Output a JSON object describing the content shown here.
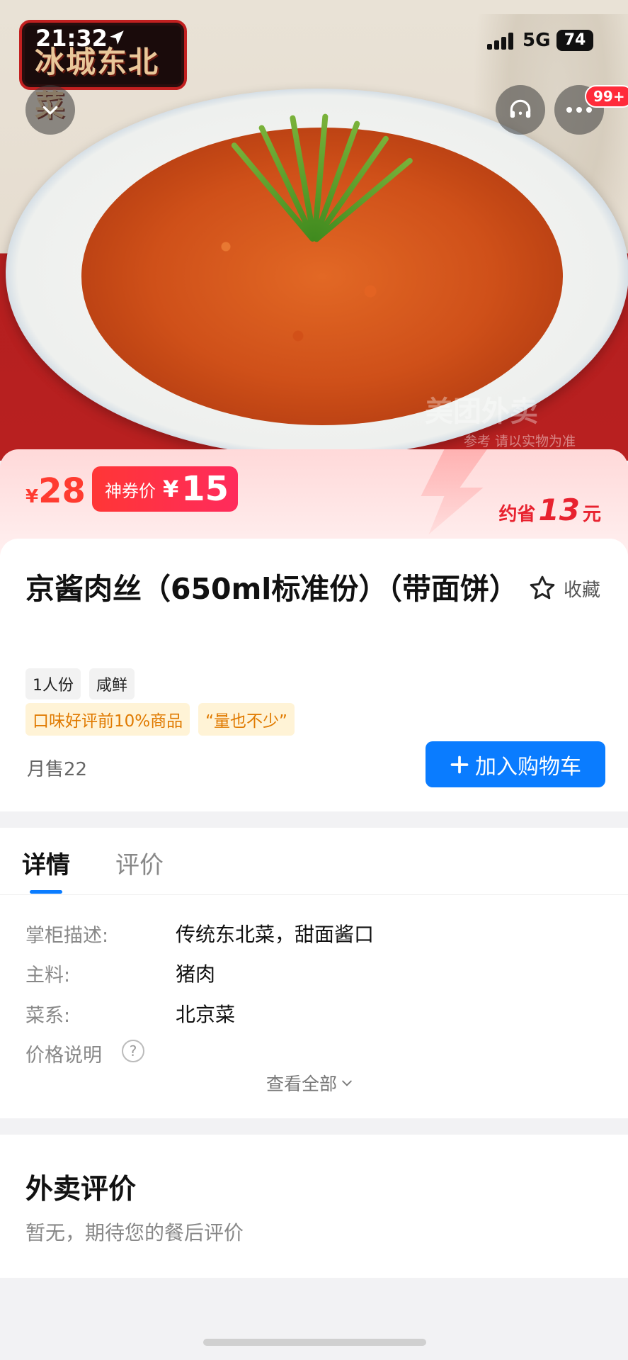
{
  "status_bar": {
    "time": "21:32",
    "network": "5G",
    "battery": "74"
  },
  "store": {
    "logo_text": "冰城东北菜"
  },
  "hero": {
    "watermark": "美团外卖",
    "watermark_note": "参考 请以实物为准"
  },
  "header": {
    "badge_count": "99+"
  },
  "price": {
    "currency": "¥",
    "original": "28",
    "coupon_label": "神券价",
    "coupon_price": "15",
    "save_prefix": "约省",
    "save_amount": "13",
    "save_suffix": "元"
  },
  "dish": {
    "title": "京酱肉丝（650ml标准份）（带面饼）",
    "favorite_label": "收藏",
    "tags": [
      "1人份",
      "咸鲜"
    ],
    "highlights": [
      "口味好评前10%商品",
      "“量也不少”"
    ],
    "monthly_sales": "月售22",
    "add_to_cart": "加入购物车"
  },
  "tabs": {
    "detail": "详情",
    "reviews": "评价"
  },
  "details": {
    "rows": [
      {
        "label": "掌柜描述:",
        "value": "传统东北菜，甜面酱口"
      },
      {
        "label": "主料:",
        "value": "猪肉"
      },
      {
        "label": "菜系:",
        "value": "北京菜"
      },
      {
        "label": "价格说明",
        "value": ""
      }
    ],
    "see_all": "查看全部"
  },
  "reviews": {
    "title": "外卖评价",
    "empty": "暂无，期待您的餐后评价"
  },
  "colors": {
    "accent": "#0a7cff",
    "price_red": "#ff3b30",
    "coupon_red": "#ff2b5c"
  }
}
